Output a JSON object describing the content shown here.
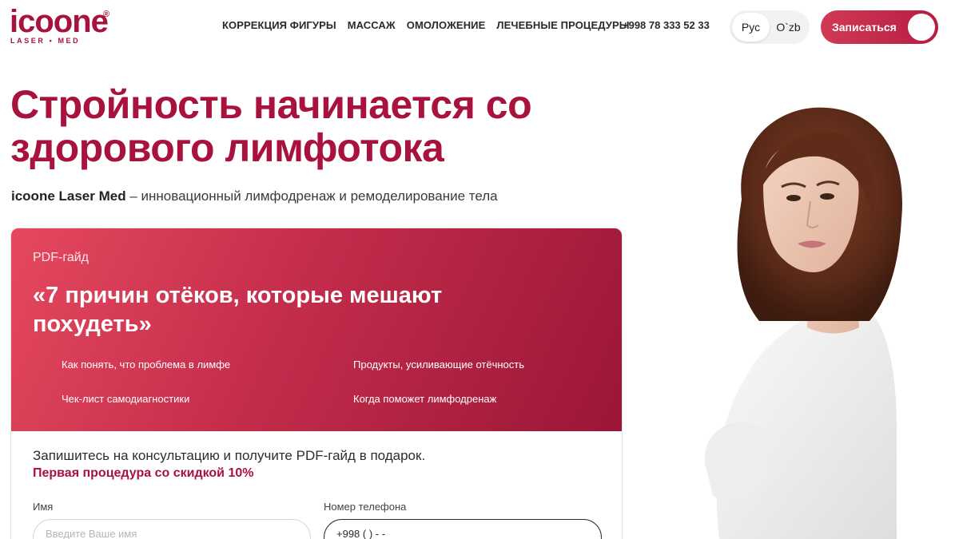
{
  "header": {
    "logo_main": "icoone",
    "logo_reg": "®",
    "logo_sub": "LASER • MED",
    "nav": [
      "КОРРЕКЦИЯ ФИГУРЫ",
      "МАССАЖ",
      "ОМОЛОЖЕНИЕ",
      "ЛЕЧЕБНЫЕ ПРОЦЕДУРЫ"
    ],
    "phone": "+998 78 333 52 33",
    "languages": [
      "Рус",
      "O`zb"
    ],
    "active_language": "Рус",
    "cta_label": "Записаться"
  },
  "hero": {
    "title": "Стройность начинается со здорового лимфотока",
    "subtitle_brand": "icoone Laser Med",
    "subtitle_text": " – инновационный лимфодренаж и ремоделирование тела"
  },
  "guide": {
    "tag": "PDF-гайд",
    "title": "«7 причин отёков, которые мешают похудеть»",
    "bullets": [
      "Как понять, что проблема в лимфе",
      "Продукты, усиливающие отёчность",
      "Чек-лист самодиагностики",
      "Когда поможет лимфодренаж"
    ]
  },
  "form": {
    "intro": "Запишитесь на консультацию и получите PDF-гайд в подарок.",
    "promo": "Первая процедура со скидкой 10%",
    "name_label": "Имя",
    "name_placeholder": "Введите Ваше имя",
    "phone_label": "Номер телефона",
    "phone_value": "+998 (   )    -   -"
  },
  "colors": {
    "brand": "#a8123c",
    "card_gradient_start": "#e5495f",
    "card_gradient_end": "#9a1636"
  },
  "icons": {
    "photo": "woman-portrait-image"
  }
}
